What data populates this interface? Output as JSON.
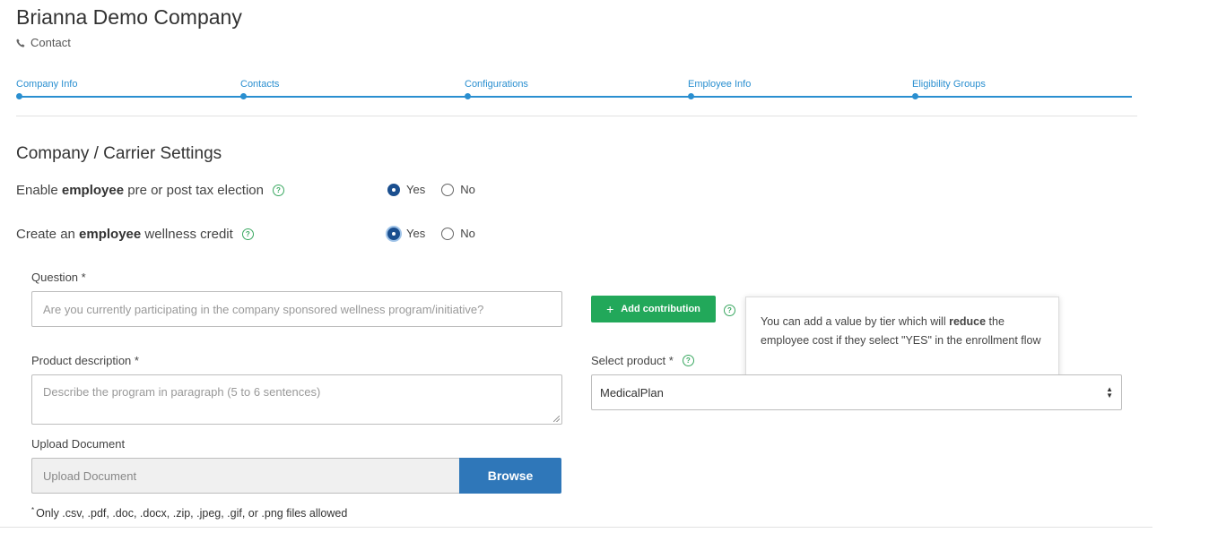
{
  "header": {
    "company_name": "Brianna Demo Company",
    "contact_label": "Contact"
  },
  "stepper": {
    "steps": [
      "Company Info",
      "Contacts",
      "Configurations",
      "Employee Info",
      "Eligibility Groups"
    ],
    "accent_color": "#2a8fd0"
  },
  "section": {
    "title": "Company / Carrier Settings"
  },
  "settings": {
    "tax_election": {
      "label_prefix": "Enable ",
      "label_bold": "employee",
      "label_suffix": " pre or post tax election",
      "yes": "Yes",
      "no": "No",
      "selected": "Yes"
    },
    "wellness_credit": {
      "label_prefix": "Create an ",
      "label_bold": "employee",
      "label_suffix": " wellness credit",
      "yes": "Yes",
      "no": "No",
      "selected": "Yes"
    }
  },
  "form": {
    "question_label": "Question *",
    "question_placeholder": "Are you currently participating in the company sponsored wellness program/initiative?",
    "add_contribution": "Add contribution",
    "tooltip": {
      "prefix": "You can add a value by tier which will ",
      "bold": "reduce",
      "suffix": " the employee cost if they select \"YES\" in the enrollment flow"
    },
    "description_label": "Product description *",
    "description_placeholder": "Describe the program in paragraph (5 to 6 sentences)",
    "select_product_label": "Select product *",
    "select_product_value": "MedicalPlan",
    "upload_label": "Upload Document",
    "upload_placeholder": "Upload Document",
    "browse": "Browse",
    "file_note_marker": "*",
    "file_note": "Only .csv, .pdf, .doc, .docx, .zip, .jpeg, .gif, or .png files allowed"
  },
  "colors": {
    "primary_button": "#2f77b9",
    "success_button": "#22a85a",
    "radio_checked": "#1b4f8f"
  }
}
